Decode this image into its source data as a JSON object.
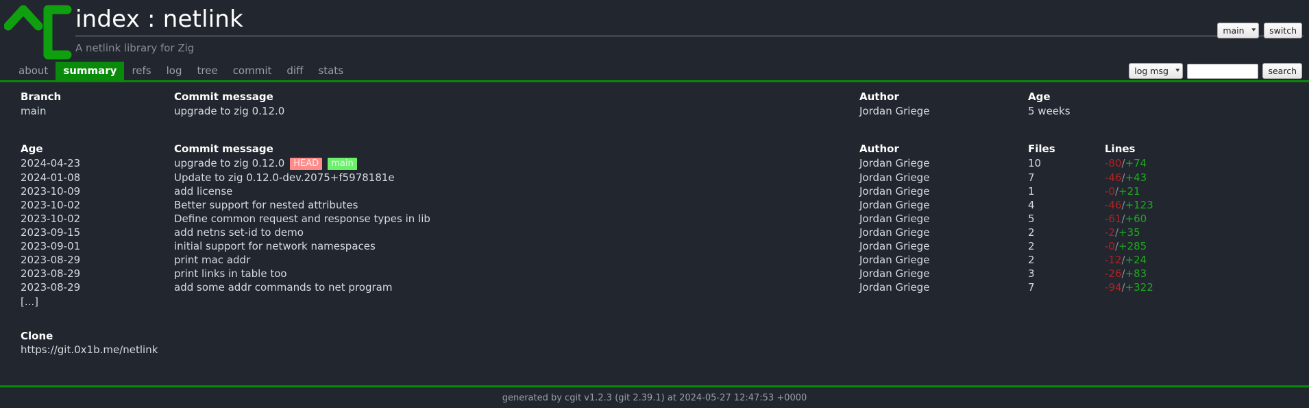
{
  "header": {
    "logo_icon": "cgit-caret-bracket-logo",
    "title": "index : netlink",
    "description": "A netlink library for Zig",
    "branch_select_value": "main",
    "switch_label": "switch"
  },
  "nav": {
    "tabs": [
      {
        "label": "about",
        "active": false
      },
      {
        "label": "summary",
        "active": true
      },
      {
        "label": "refs",
        "active": false
      },
      {
        "label": "log",
        "active": false
      },
      {
        "label": "tree",
        "active": false
      },
      {
        "label": "commit",
        "active": false
      },
      {
        "label": "diff",
        "active": false
      },
      {
        "label": "stats",
        "active": false
      }
    ],
    "search_scope_value": "log msg",
    "search_input_value": "",
    "search_input_placeholder": "",
    "search_button_label": "search"
  },
  "branch_table": {
    "headers": {
      "branch": "Branch",
      "commit_message": "Commit message",
      "author": "Author",
      "age": "Age"
    },
    "rows": [
      {
        "branch": "main",
        "commit_message": "upgrade to zig 0.12.0",
        "author": "Jordan Griege",
        "age": "5 weeks"
      }
    ]
  },
  "log_table": {
    "headers": {
      "age": "Age",
      "commit_message": "Commit message",
      "author": "Author",
      "files": "Files",
      "lines": "Lines"
    },
    "rows": [
      {
        "age": "2024-04-23",
        "message": "upgrade to zig 0.12.0",
        "decorations": [
          {
            "label": "HEAD",
            "kind": "head"
          },
          {
            "label": "main",
            "kind": "branch"
          }
        ],
        "author": "Jordan Griege",
        "files": "10",
        "deletions": "-80",
        "insertions": "+74"
      },
      {
        "age": "2024-01-08",
        "message": "Update to zig 0.12.0-dev.2075+f5978181e",
        "decorations": [],
        "author": "Jordan Griege",
        "files": "7",
        "deletions": "-46",
        "insertions": "+43"
      },
      {
        "age": "2023-10-09",
        "message": "add license",
        "decorations": [],
        "author": "Jordan Griege",
        "files": "1",
        "deletions": "-0",
        "insertions": "+21"
      },
      {
        "age": "2023-10-02",
        "message": "Better support for nested attributes",
        "decorations": [],
        "author": "Jordan Griege",
        "files": "4",
        "deletions": "-46",
        "insertions": "+123"
      },
      {
        "age": "2023-10-02",
        "message": "Define common request and response types in lib",
        "decorations": [],
        "author": "Jordan Griege",
        "files": "5",
        "deletions": "-61",
        "insertions": "+60"
      },
      {
        "age": "2023-09-15",
        "message": "add netns set-id to demo",
        "decorations": [],
        "author": "Jordan Griege",
        "files": "2",
        "deletions": "-2",
        "insertions": "+35"
      },
      {
        "age": "2023-09-01",
        "message": "initial support for network namespaces",
        "decorations": [],
        "author": "Jordan Griege",
        "files": "2",
        "deletions": "-0",
        "insertions": "+285"
      },
      {
        "age": "2023-08-29",
        "message": "print mac addr",
        "decorations": [],
        "author": "Jordan Griege",
        "files": "2",
        "deletions": "-12",
        "insertions": "+24"
      },
      {
        "age": "2023-08-29",
        "message": "print links in table too",
        "decorations": [],
        "author": "Jordan Griege",
        "files": "3",
        "deletions": "-26",
        "insertions": "+83"
      },
      {
        "age": "2023-08-29",
        "message": "add some addr commands to net program",
        "decorations": [],
        "author": "Jordan Griege",
        "files": "7",
        "deletions": "-94",
        "insertions": "+322"
      }
    ],
    "more_indicator": "[...]"
  },
  "clone": {
    "heading": "Clone",
    "url": "https://git.0x1b.me/netlink"
  },
  "footer": {
    "text": "generated by cgit v1.2.3 (git 2.39.1) at 2024-05-27 12:47:53 +0000"
  },
  "colors": {
    "background": "#22262e",
    "accent_green": "#0a8a0a",
    "head_badge": "#ff8a8a",
    "branch_badge": "#6cf06c",
    "deletion_red": "#b22222",
    "insertion_green": "#1faa1f"
  }
}
